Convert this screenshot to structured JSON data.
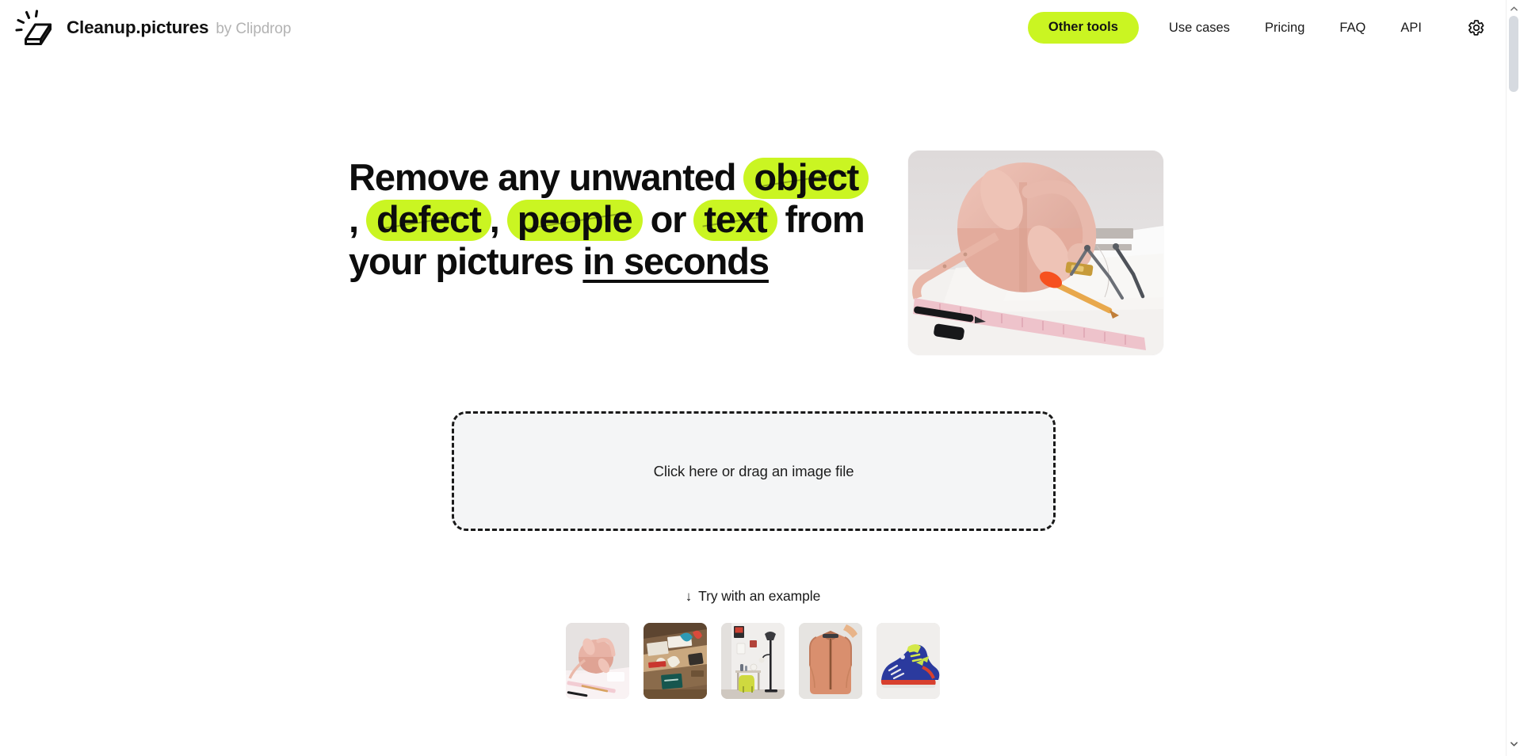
{
  "header": {
    "logo_icon": "eraser-sparkle-icon",
    "brand_name": "Cleanup.pictures",
    "brand_suffix": "by Clipdrop",
    "nav": {
      "other_tools": "Other tools",
      "use_cases": "Use cases",
      "pricing": "Pricing",
      "faq": "FAQ",
      "api": "API",
      "settings_icon": "gear-icon"
    }
  },
  "hero": {
    "headline": {
      "part1": "Remove any unwanted",
      "highlight1": "object",
      "sep1": ",",
      "highlight2": "defect",
      "sep2": ",",
      "highlight3": "people",
      "part2": "or",
      "highlight4": "text",
      "part3": "from your pictures",
      "underlined": "in seconds"
    },
    "image_alt": "pink leather bag with design tools on a desk"
  },
  "dropzone": {
    "label": "Click here or drag an image file"
  },
  "examples": {
    "arrow_icon": "arrow-down-icon",
    "title": "Try with an example",
    "items": [
      {
        "alt": "pink bag on sketchpad"
      },
      {
        "alt": "cluttered craft workbench"
      },
      {
        "alt": "home office with yellow chair"
      },
      {
        "alt": "salmon bomber jacket on hanger"
      },
      {
        "alt": "blue and yellow sneaker"
      }
    ]
  },
  "scrollbar": {
    "up_icon": "chevron-up-icon",
    "down_icon": "chevron-down-icon"
  },
  "colors": {
    "accent_lime": "#caf522",
    "text_primary": "#111111",
    "text_muted": "#b3b3b3",
    "dropzone_bg": "#f4f5f6",
    "page_bg": "#ffffff"
  }
}
